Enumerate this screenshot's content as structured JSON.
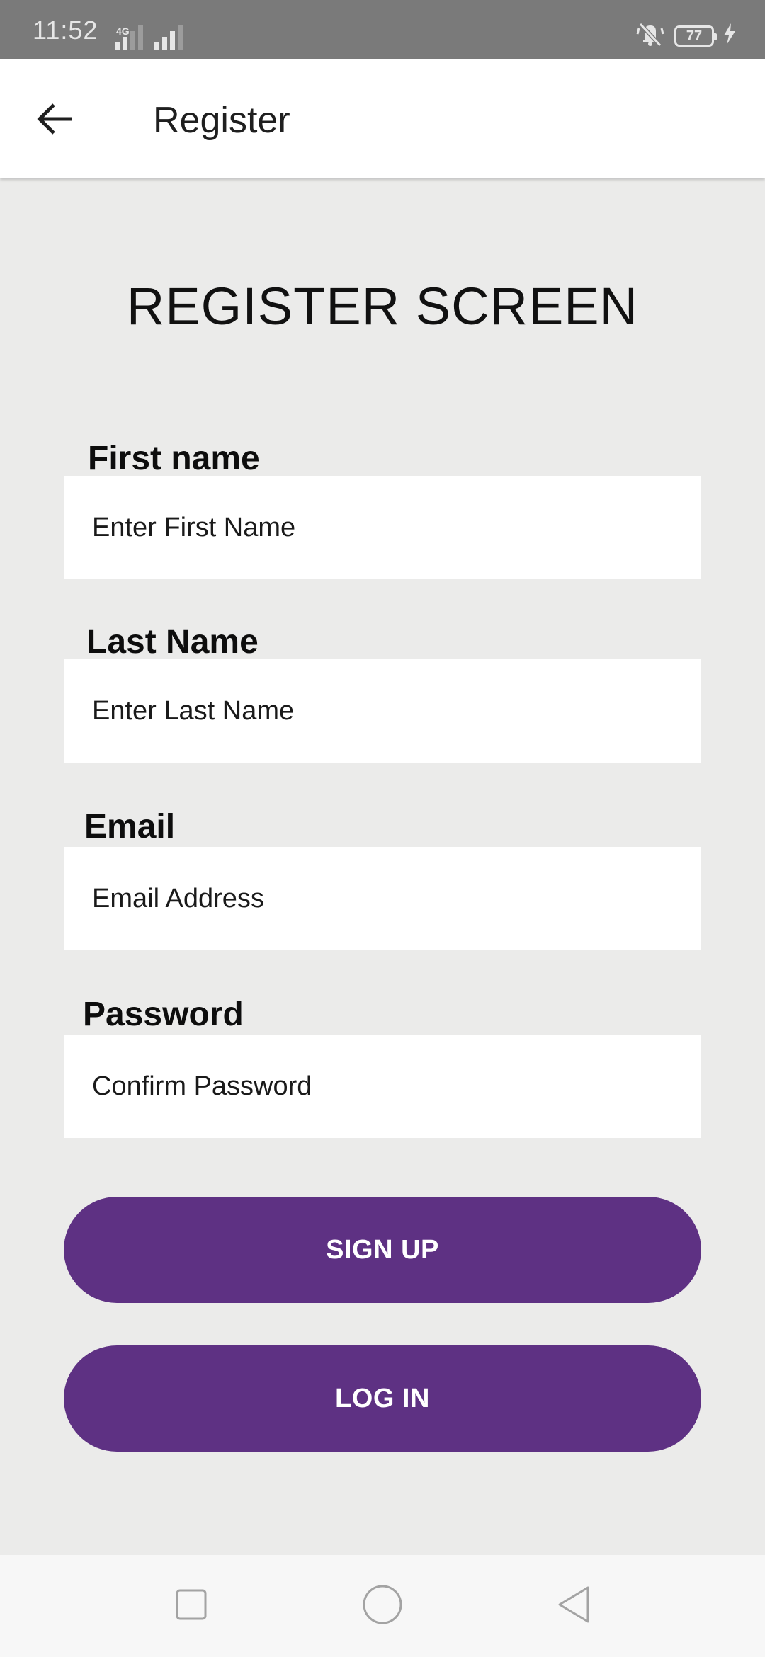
{
  "status_bar": {
    "time": "11:52",
    "network": "4G",
    "battery": "77"
  },
  "app_bar": {
    "title": "Register"
  },
  "main": {
    "heading": "REGISTER SCREEN",
    "fields": [
      {
        "label": "First name",
        "placeholder": "Enter First Name"
      },
      {
        "label": "Last Name",
        "placeholder": "Enter Last Name"
      },
      {
        "label": "Email",
        "placeholder": "Email Address"
      },
      {
        "label": "Password",
        "placeholder": "Confirm Password"
      }
    ],
    "signup_label": "SIGN UP",
    "login_label": "LOG IN"
  },
  "colors": {
    "accent": "#5e3183",
    "background": "#ebebea",
    "status_bar": "#7a7a7a"
  },
  "icons": {
    "back": "arrow-left-icon",
    "nav_recent": "square-icon",
    "nav_home": "circle-icon",
    "nav_back": "triangle-back-icon"
  }
}
